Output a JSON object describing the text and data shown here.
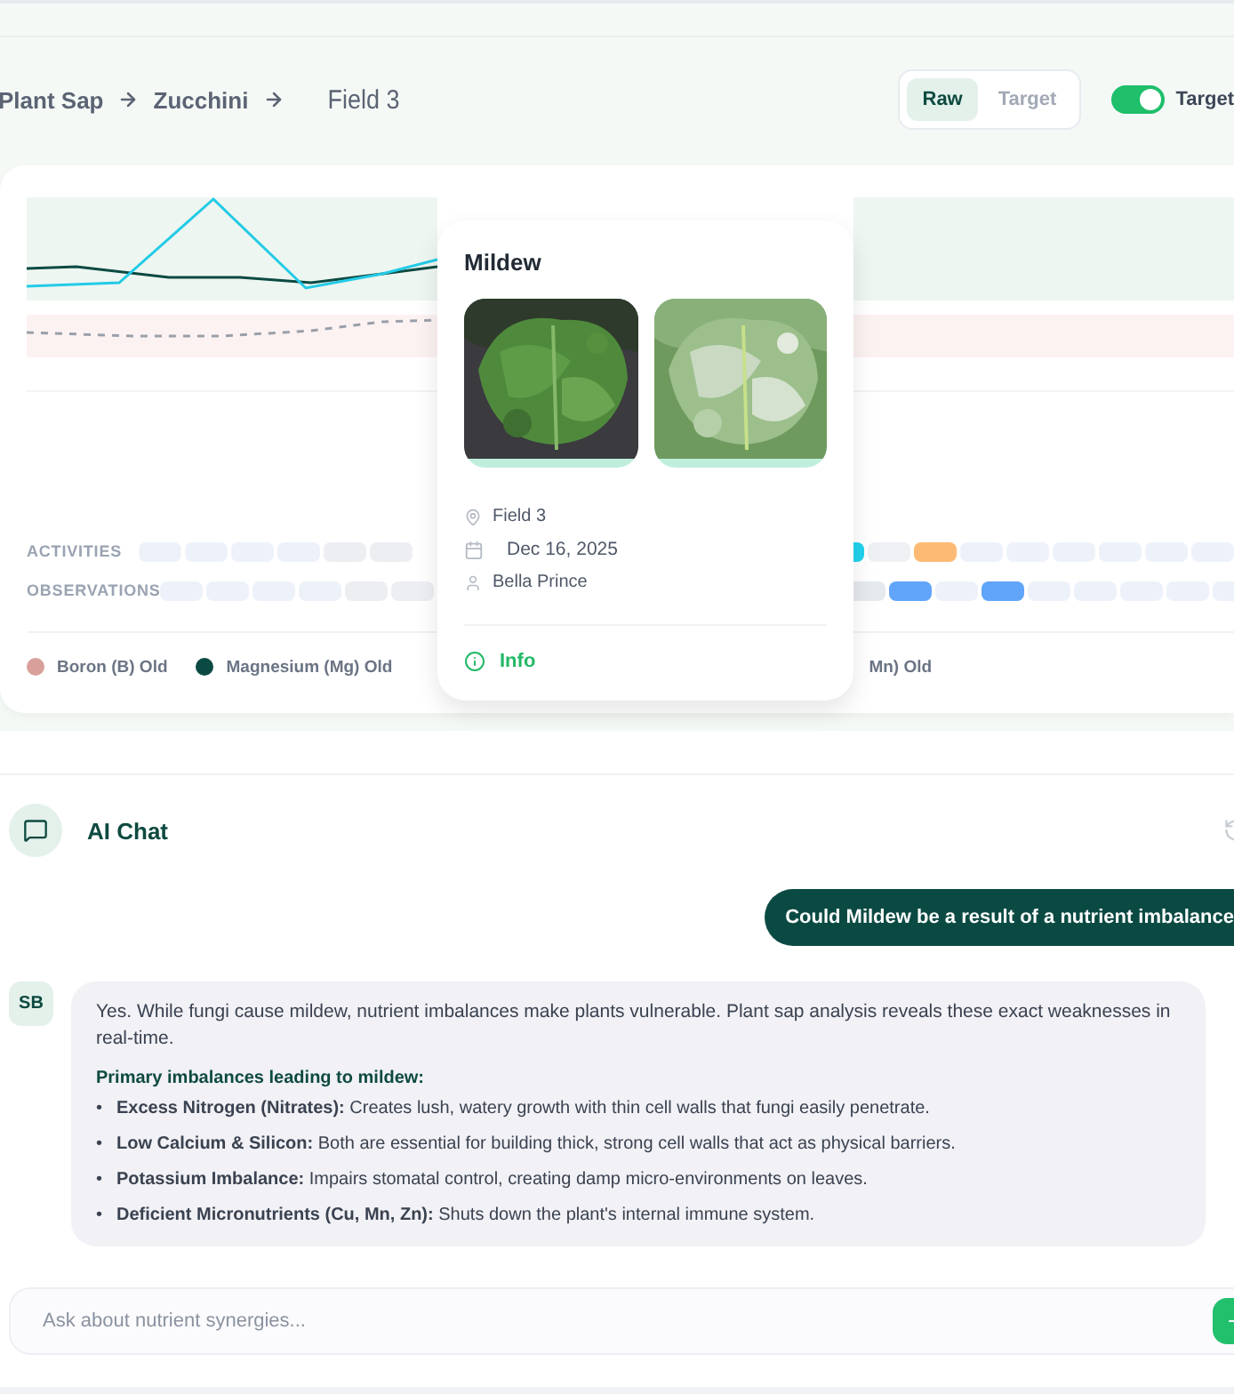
{
  "breadcrumb": [
    {
      "label": "Plant Sap"
    },
    {
      "label": "Zucchini"
    },
    {
      "label": "Field 3"
    }
  ],
  "view_toggle": [
    {
      "label": "Raw",
      "selected": true
    },
    {
      "label": "Target",
      "selected": false
    }
  ],
  "target_switch": {
    "label": "Target",
    "on": true
  },
  "timeline": [
    {
      "label": "ACTIVITIES",
      "cells_left": [
        {
          "color": "#edf2fa"
        },
        {
          "color": "#edf2fa"
        },
        {
          "color": "#edf2fa"
        },
        {
          "color": "#edf2fa"
        },
        {
          "color": "#eceef2"
        },
        {
          "color": "#eceef2"
        }
      ],
      "cells_right": [
        {
          "color": "#22d3ee"
        },
        {
          "color": "#eef0f4"
        },
        {
          "color": "#fdba74"
        },
        {
          "color": "#edf2fa"
        },
        {
          "color": "#edf2fa"
        },
        {
          "color": "#edf2fa"
        },
        {
          "color": "#edf2fa"
        },
        {
          "color": "#edf2fa"
        },
        {
          "color": "#edf2fa"
        }
      ]
    },
    {
      "label": "OBSERVATIONS",
      "cells_left": [
        {
          "color": "#edf2fa"
        },
        {
          "color": "#edf2fa"
        },
        {
          "color": "#edf2fa"
        },
        {
          "color": "#edf2fa"
        },
        {
          "color": "#eceef2"
        },
        {
          "color": "#eceef2"
        }
      ],
      "cells_right": [
        {
          "color": "#e6e9ee"
        },
        {
          "color": "#60a5fa"
        },
        {
          "color": "#edf2fa"
        },
        {
          "color": "#60a5fa"
        },
        {
          "color": "#edf2fa"
        },
        {
          "color": "#edf2fa"
        },
        {
          "color": "#edf2fa"
        },
        {
          "color": "#edf2fa"
        },
        {
          "color": "#edf2fa"
        }
      ]
    }
  ],
  "legend": [
    {
      "label": "Boron (B) Old",
      "color": "#d9a09b"
    },
    {
      "label": "Magnesium (Mg) Old",
      "color": "#0b4a43"
    },
    {
      "label": "Mn) Old"
    }
  ],
  "popover": {
    "title": "Mildew",
    "details": [
      {
        "kind": "location",
        "text": "Field 3"
      },
      {
        "kind": "date",
        "text": "Dec 16, 2025"
      },
      {
        "kind": "person",
        "text": "Bella Prince"
      }
    ],
    "link": "Info"
  },
  "chat": {
    "title": "AI Chat",
    "messages": [
      {
        "kind": "user",
        "text": "Could Mildew be a result of a nutrient imbalance"
      },
      {
        "kind": "assistant",
        "avatar": "SB",
        "intro": "Yes. While fungi cause mildew, nutrient imbalances make plants vulnerable. Plant sap analysis reveals these exact weaknesses in real-time.",
        "heading": "Primary imbalances leading to mildew:",
        "points": [
          {
            "marker": "•",
            "text": "**Excess Nitrogen (Nitrates):** Creates lush, watery growth with thin cell walls that fungi easily penetrate."
          },
          {
            "marker": "•",
            "text": "**Low Calcium & Silicon:** Both are essential for building thick, strong cell walls that act as physical barriers."
          },
          {
            "marker": "•",
            "text": "**Potassium Imbalance:** Impairs stomatal control, creating damp micro-environments on leaves."
          },
          {
            "marker": "•",
            "text": "**Deficient Micronutrients (Cu, Mn, Zn):** Shuts down the plant's internal immune system."
          }
        ]
      }
    ],
    "input": {
      "placeholder": "Ask about nutrient synergies..."
    }
  }
}
